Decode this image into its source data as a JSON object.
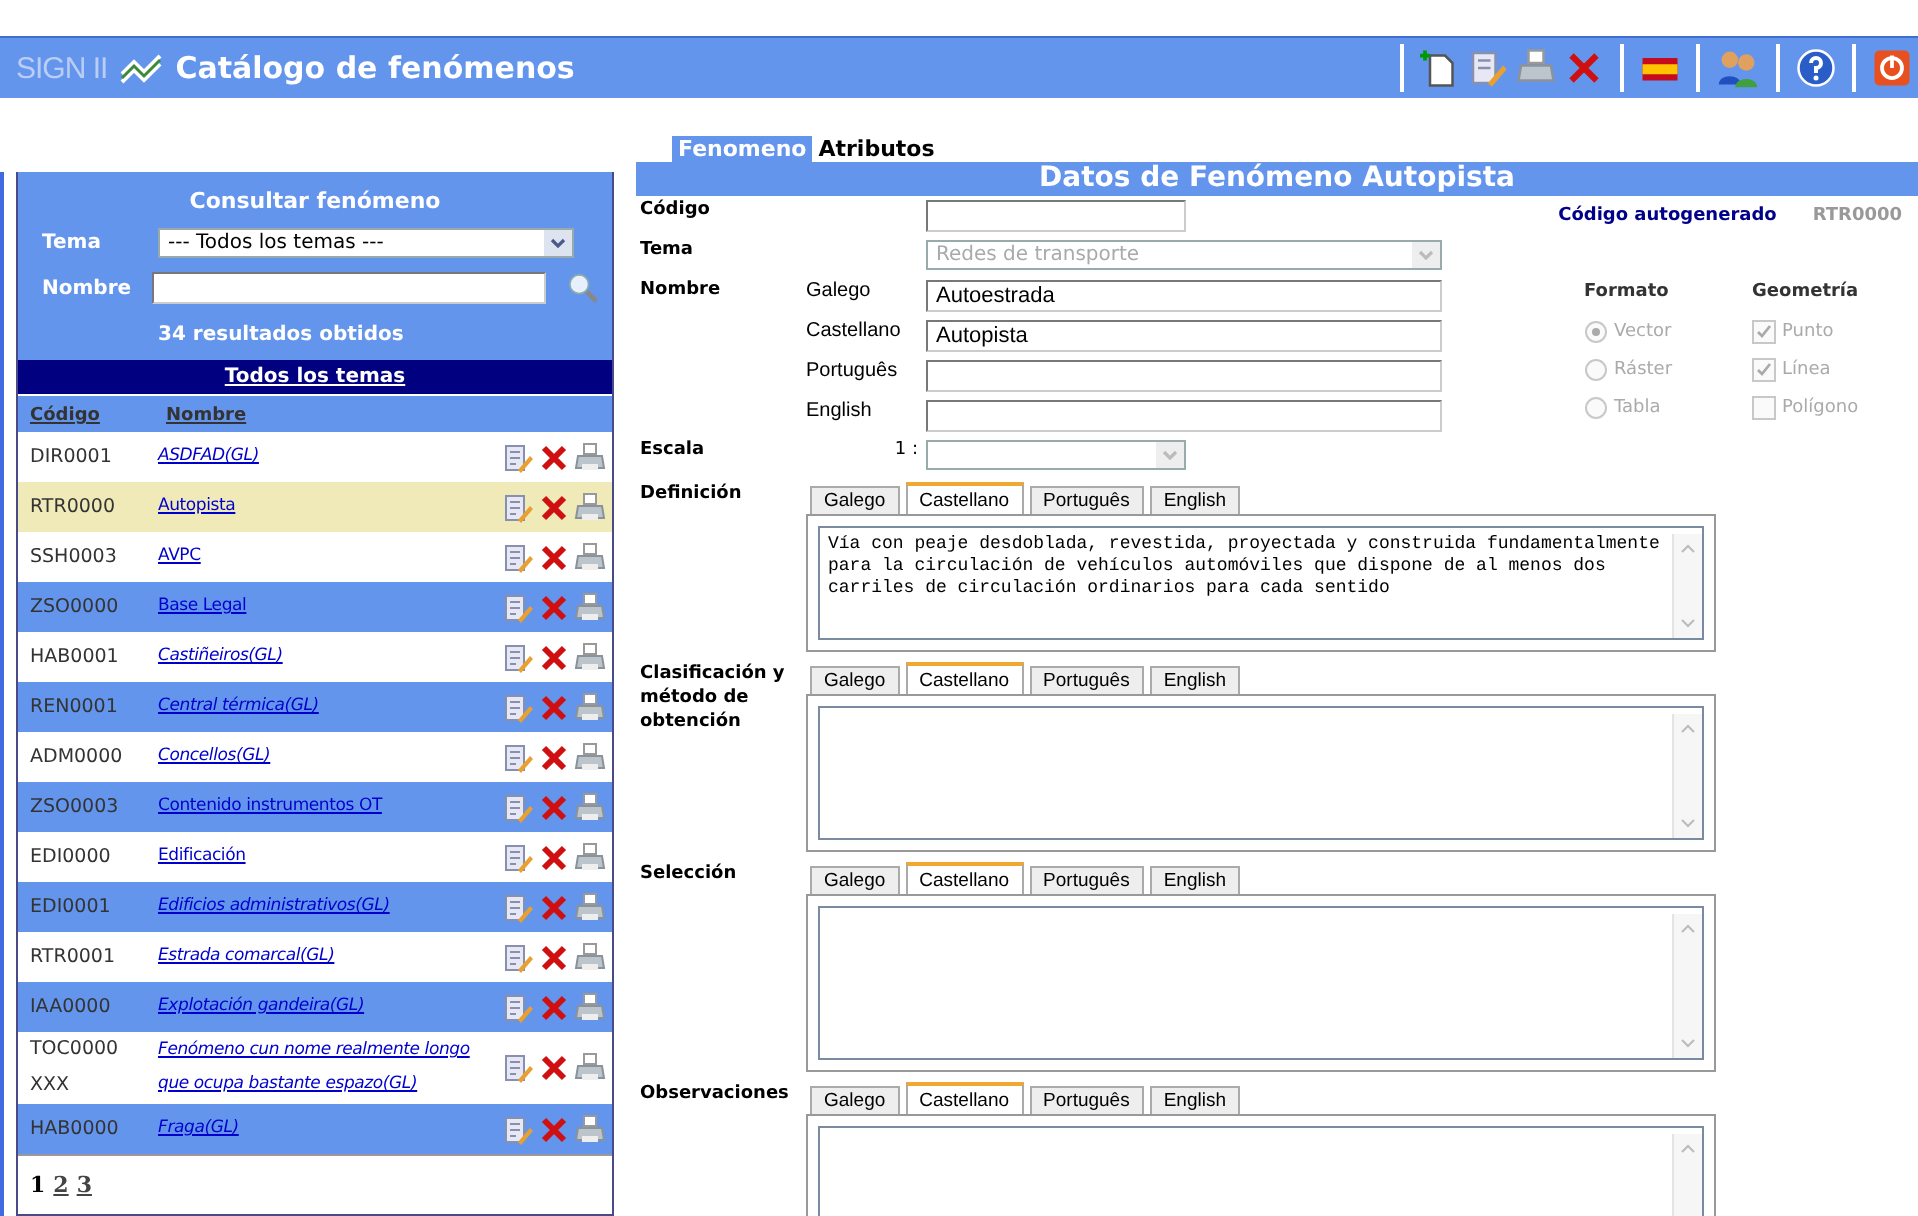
{
  "header": {
    "logo": "SIGN II",
    "title": "Catálogo de fenómenos"
  },
  "toolbar": [
    {
      "kind": "new",
      "separated": true
    },
    {
      "kind": "edit",
      "separated": false
    },
    {
      "kind": "print",
      "separated": false
    },
    {
      "kind": "delete",
      "separated": false
    },
    {
      "kind": "language",
      "separated": true
    },
    {
      "kind": "users",
      "separated": true
    },
    {
      "kind": "help",
      "separated": true
    },
    {
      "kind": "exit",
      "separated": true
    }
  ],
  "search": {
    "title": "Consultar fenómeno",
    "tema_label": "Tema",
    "tema_value": "--- Todos los temas ---",
    "nombre_label": "Nombre",
    "results": "34 resultados obtidos",
    "theme_bar": "Todos los temas"
  },
  "list": {
    "columns": [
      "Código",
      "Nombre"
    ],
    "rows": [
      {
        "code": "DIR0001",
        "name": "ASDFAD(GL)",
        "italic": true,
        "selected": false
      },
      {
        "code": "RTR0000",
        "name": "Autopista",
        "italic": false,
        "selected": true
      },
      {
        "code": "SSH0003",
        "name": "AVPC",
        "italic": false,
        "selected": false
      },
      {
        "code": "ZSO0000",
        "name": "Base Legal",
        "italic": false,
        "selected": false
      },
      {
        "code": "HAB0001",
        "name": "Castiñeiros(GL)",
        "italic": true,
        "selected": false
      },
      {
        "code": "REN0001",
        "name": "Central térmica(GL)",
        "italic": true,
        "selected": false
      },
      {
        "code": "ADM0000",
        "name": "Concellos(GL)",
        "italic": true,
        "selected": false
      },
      {
        "code": "ZSO0003",
        "name": "Contenido instrumentos OT",
        "italic": false,
        "selected": false
      },
      {
        "code": "EDI0000",
        "name": "Edificación",
        "italic": false,
        "selected": false
      },
      {
        "code": "EDI0001",
        "name": "Edificios administrativos(GL)",
        "italic": true,
        "selected": false
      },
      {
        "code": "RTR0001",
        "name": "Estrada comarcal(GL)",
        "italic": true,
        "selected": false
      },
      {
        "code": "IAA0000",
        "name": "Explotación gandeira(GL)",
        "italic": true,
        "selected": false
      },
      {
        "code": "TOC0000 XXX",
        "name": "Fenómeno cun nome realmente longo que ocupa bastante espazo(GL)",
        "italic": true,
        "selected": false
      },
      {
        "code": "HAB0000",
        "name": "Fraga(GL)",
        "italic": true,
        "selected": false
      }
    ],
    "pages": [
      {
        "label": "1",
        "selected": true
      },
      {
        "label": "2",
        "selected": false
      },
      {
        "label": "3",
        "selected": false
      }
    ]
  },
  "tabs": [
    {
      "label": "Fenomeno",
      "selected": true
    },
    {
      "label": "Atributos",
      "selected": false
    }
  ],
  "form": {
    "title": "Datos de Fenómeno Autopista",
    "codigo": {
      "label": "Código",
      "autogen_label": "Código autogenerado",
      "autogen_value": "RTR0000"
    },
    "tema": {
      "label": "Tema",
      "value": "Redes de transporte",
      "disabled": true
    },
    "nombre": {
      "label": "Nombre",
      "entries": [
        {
          "lang": "Galego",
          "value": "Autoestrada"
        },
        {
          "lang": "Castellano",
          "value": "Autopista"
        },
        {
          "lang": "Português"
        },
        {
          "lang": "English"
        }
      ]
    },
    "escala": {
      "label": "Escala",
      "prefix": "1 :",
      "disabled": true
    },
    "formato": {
      "label": "Formato",
      "disabled": true,
      "options": [
        {
          "label": "Vector",
          "selected": true
        },
        {
          "label": "Ráster",
          "selected": false
        },
        {
          "label": "Tabla",
          "selected": false
        }
      ]
    },
    "geometria": {
      "label": "Geometría",
      "disabled": true,
      "options": [
        {
          "label": "Punto",
          "checked": true
        },
        {
          "label": "Línea",
          "checked": true
        },
        {
          "label": "Polígono",
          "checked": false
        }
      ]
    },
    "sections": [
      {
        "label": "Definición",
        "tabs": [
          {
            "label": "Galego",
            "selected": false
          },
          {
            "label": "Castellano",
            "selected": true
          },
          {
            "label": "Português",
            "selected": false
          },
          {
            "label": "English",
            "selected": false
          }
        ],
        "value": "Vía con peaje desdoblada, revestida, proyectada y construida fundamentalmente para la circulación de vehículos automóviles que dispone de al menos dos carriles de circulación ordinarios para cada sentido"
      },
      {
        "label": "Clasificación y método de obtención",
        "tabs": [
          {
            "label": "Galego",
            "selected": false
          },
          {
            "label": "Castellano",
            "selected": true
          },
          {
            "label": "Português",
            "selected": false
          },
          {
            "label": "English",
            "selected": false
          }
        ]
      },
      {
        "label": "Selección",
        "tabs": [
          {
            "label": "Galego",
            "selected": false
          },
          {
            "label": "Castellano",
            "selected": true
          },
          {
            "label": "Português",
            "selected": false
          },
          {
            "label": "English",
            "selected": false
          }
        ]
      },
      {
        "label": "Observaciones",
        "tabs": [
          {
            "label": "Galego",
            "selected": false
          },
          {
            "label": "Castellano",
            "selected": true
          },
          {
            "label": "Português",
            "selected": false
          },
          {
            "label": "English",
            "selected": false
          }
        ]
      }
    ]
  }
}
